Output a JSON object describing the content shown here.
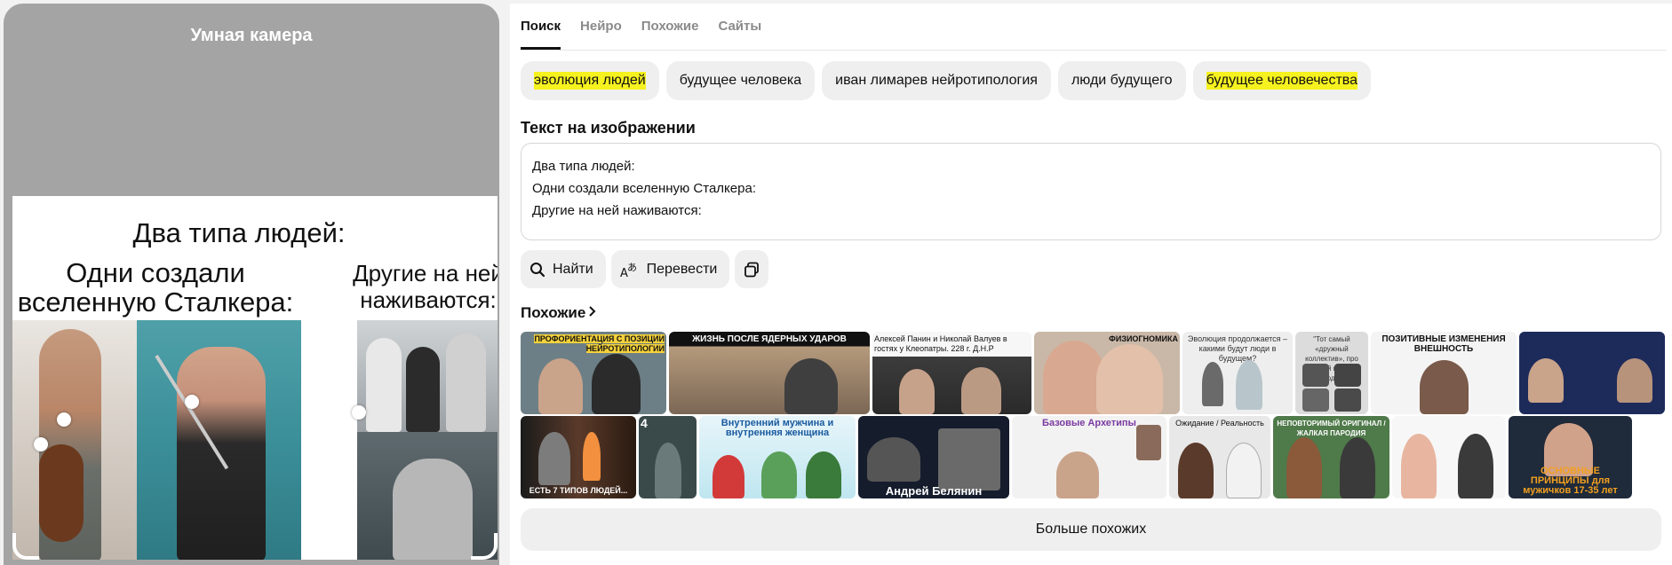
{
  "camera": {
    "title": "Умная камера",
    "image_text": {
      "headline": "Два типа людей:",
      "left_caption_line1": "Одни создали",
      "left_caption_line2": "вселенную Сталкера:",
      "right_caption_line1": "Другие на ней",
      "right_caption_line2": "наживаются:"
    }
  },
  "tabs": [
    {
      "label": "Поиск",
      "active": true
    },
    {
      "label": "Нейро",
      "active": false
    },
    {
      "label": "Похожие",
      "active": false
    },
    {
      "label": "Сайты",
      "active": false
    }
  ],
  "chips": [
    {
      "label": "эволюция людей",
      "highlighted": true
    },
    {
      "label": "будущее человека",
      "highlighted": false
    },
    {
      "label": "иван лимарев нейротипология",
      "highlighted": false
    },
    {
      "label": "люди будущего",
      "highlighted": false
    },
    {
      "label": "будущее человечества",
      "highlighted": true
    }
  ],
  "text_on_image": {
    "title": "Текст на изображении",
    "lines": [
      "Два типа людей:",
      "Одни создали вселенную Сталкера:",
      "Другие на ней наживаются:"
    ]
  },
  "actions": {
    "find_label": "Найти",
    "translate_label": "Перевести",
    "copy_icon": "copy-icon"
  },
  "similar": {
    "title": "Похожие",
    "more_label": "Больше похожих",
    "row1": [
      {
        "caption": "ПРОФОРИЕНТАЦИЯ С ПОЗИЦИИ НЕЙРОТИПОЛОГИИ",
        "bg": "#6d7f86"
      },
      {
        "caption": "ЖИЗНЬ ПОСЛЕ ЯДЕРНЫХ УДАРОВ",
        "bg": "#7a6a5a"
      },
      {
        "caption": "Алексей Панин и Николай Валуев в гостях у Клеопатры. 228 г. Д.Н.Р",
        "bg": "#3c3c3c"
      },
      {
        "caption": "ФИЗИОГНОМИКА",
        "bg": "#c9b8a8"
      },
      {
        "caption": "Эволюция продолжается – какими будут люди в будущем?",
        "bg": "#e8e8e8"
      },
      {
        "caption": "\"Тот самый «дружный коллектив», про который говорил работодатель:",
        "bg": "#dcdcdc"
      },
      {
        "caption": "ПОЗИТИВНЫЕ ИЗМЕНЕНИЯ ВНЕШНОСТЬ",
        "bg": "#f4f4f4"
      },
      {
        "caption": "",
        "bg": "#1d2b5a"
      }
    ],
    "row2": [
      {
        "caption": "ЕСТЬ 7 ТИПОВ ЛЮДЕЙ...",
        "bg": "#1b1b1b"
      },
      {
        "caption": "4",
        "bg": "#3a4a4a"
      },
      {
        "caption": "Внутренний мужчина и внутренняя женщина",
        "bg": "#8fd0e0"
      },
      {
        "caption": "Андрей Белянин",
        "bg": "#151c2c"
      },
      {
        "caption": "Базовые Архетипы",
        "bg": "#f2f2f2"
      },
      {
        "caption": "Ожидание / Реальность",
        "bg": "#e8e8e8"
      },
      {
        "caption": "НЕПОВТОРИМЫЙ ОРИГИНАЛ / ЖАЛКАЯ ПАРОДИЯ",
        "bg": "#4f7a4a"
      },
      {
        "caption": "",
        "bg": "#f7f7f7"
      },
      {
        "caption": "ОСНОВНЫЕ ПРИНЦИПЫ для мужичков 17-35 лет",
        "bg": "#1f2a3a"
      }
    ]
  }
}
